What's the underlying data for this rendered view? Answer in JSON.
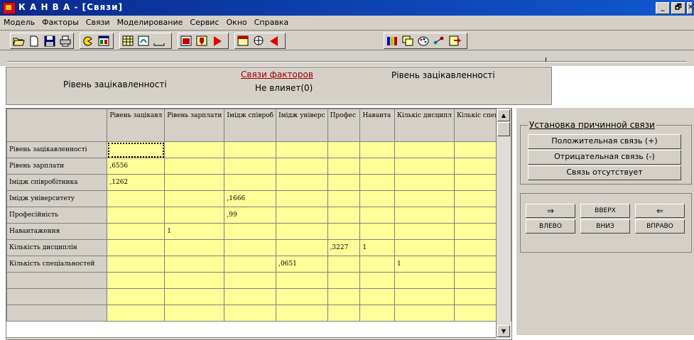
{
  "window": {
    "title": "К А Н В А - [Связи]",
    "controls": [
      "_",
      "🗗",
      "✕"
    ]
  },
  "menu": [
    "Модель",
    "Факторы",
    "Связи",
    "Моделирование",
    "Сервис",
    "Окно",
    "Справка"
  ],
  "toolbar": {
    "icons": [
      "open-icon",
      "new-icon",
      "save-icon",
      "print-icon",
      "pacman-icon",
      "window-split-icon",
      "grid-icon",
      "swirl-icon",
      "spacer-icon",
      "run-icon",
      "drop-icon",
      "play-red-icon",
      "grid-red-icon",
      "globe-icon",
      "play-left-icon",
      "chart-bar-icon",
      "window-copy-icon",
      "palette-icon",
      "nodes-icon",
      "export-icon"
    ]
  },
  "header": {
    "left_factor": "Рівень зацікавленності",
    "link": "Связи факторов",
    "relation": "Не влияет(0)",
    "right_factor": "Рівень зацікавленності"
  },
  "grid": {
    "columns": [
      "Рівень зацікавл",
      "Рівень зарплати",
      "Імідж співроб",
      "Імідж універс",
      "Профес",
      "Наванта",
      "Кількіс дисципл",
      "Кількіс спеціал"
    ],
    "rows": [
      {
        "label": "Рівень зацікавленності",
        "cells": [
          "",
          "",
          "",
          "",
          "",
          "",
          "",
          ""
        ]
      },
      {
        "label": "Рівень зарплати",
        "cells": [
          ",6556",
          "",
          "",
          "",
          "",
          "",
          "",
          ""
        ]
      },
      {
        "label": "Імідж співробітника",
        "cells": [
          ",1262",
          "",
          "",
          "",
          "",
          "",
          "",
          ""
        ]
      },
      {
        "label": "Імідж університету",
        "cells": [
          "",
          "",
          ",1666",
          "",
          "",
          "",
          "",
          ""
        ]
      },
      {
        "label": "Професійність",
        "cells": [
          "",
          "",
          ",99",
          "",
          "",
          "",
          "",
          ""
        ]
      },
      {
        "label": "Навантаження",
        "cells": [
          "",
          "1",
          "",
          "",
          "",
          "",
          "",
          ""
        ]
      },
      {
        "label": "Кількість дисциплін",
        "cells": [
          "",
          "",
          "",
          "",
          ",3227",
          "1",
          "",
          ""
        ]
      },
      {
        "label": "Кількість спеціальностей",
        "cells": [
          "",
          "",
          "",
          ",0651",
          "",
          "",
          "1",
          ""
        ]
      },
      {
        "label": "",
        "cells": [
          "",
          "",
          "",
          "",
          "",
          "",
          "",
          ""
        ]
      },
      {
        "label": "",
        "cells": [
          "",
          "",
          "",
          "",
          "",
          "",
          "",
          ""
        ]
      },
      {
        "label": "",
        "cells": [
          "",
          "",
          "",
          "",
          "",
          "",
          "",
          ""
        ]
      }
    ]
  },
  "causal_panel": {
    "title": "Установка причинной связи",
    "positive": "Положительная связь (+)",
    "negative": "Отрицательная связь (-)",
    "none": "Связь отсутствует"
  },
  "nav_panel": {
    "arrow_right": "⇒",
    "up": "ВВЕРХ",
    "arrow_left": "⇐",
    "left": "ВЛЕВО",
    "down": "ВНИЗ",
    "right": "ВПРАВО"
  },
  "colors": {
    "cell_fill": "#ffff99",
    "title_bar": "#0a2a8c",
    "chrome": "#d4d0c8",
    "link": "#a00000"
  }
}
